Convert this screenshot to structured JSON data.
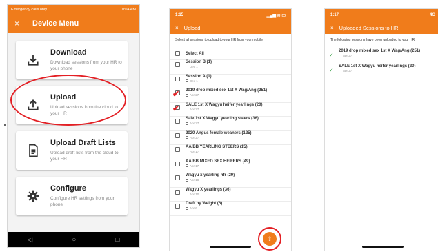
{
  "phone1": {
    "status_left": "Emergency calls only",
    "status_right": "10:04 AM",
    "close_glyph": "×",
    "title": "Device Menu",
    "cards": [
      {
        "title": "Download",
        "desc": "Download sessions from your HR to your phone",
        "icon": "download-icon"
      },
      {
        "title": "Upload",
        "desc": "Upload sessions from the cloud to your HR",
        "icon": "upload-icon"
      },
      {
        "title": "Upload Draft Lists",
        "desc": "Upload draft lists from the cloud to your HR",
        "icon": "draft-list-icon"
      },
      {
        "title": "Configure",
        "desc": "Configure HR settings from your phone",
        "icon": "gear-icon"
      }
    ],
    "nav": [
      "◁",
      "○",
      "□"
    ]
  },
  "phone2": {
    "time": "1:15",
    "close_glyph": "×",
    "title": "Upload",
    "intro": "Select all sessions to upload to your HR from your mobile",
    "select_all": "Select All",
    "sessions": [
      {
        "name": "Session B (1)",
        "date": "Dec 1",
        "checked": false
      },
      {
        "name": "Session A (0)",
        "date": "Dec 1",
        "checked": false
      },
      {
        "name": "2019 drop mixed sex 1st X Wag/Ang (251)",
        "date": "Apr 27",
        "checked": true
      },
      {
        "name": "SALE 1st X Wagyu heifer yearlings (20)",
        "date": "Apr 27",
        "checked": true
      },
      {
        "name": "Sale 1st X Wagyu yearling steers (36)",
        "date": "Apr 27",
        "checked": false
      },
      {
        "name": "2020 Angus female weaners (125)",
        "date": "Apr 27",
        "checked": false
      },
      {
        "name": "AA/BB YEARLING STEERS (15)",
        "date": "Apr 17",
        "checked": false
      },
      {
        "name": "AA/BB MIXED SEX HEIFERS (49)",
        "date": "Apr 17",
        "checked": false
      },
      {
        "name": "Wagyu x yearling hfr (20)",
        "date": "Apr 18",
        "checked": false
      },
      {
        "name": "Wagyu X yearlings (36)",
        "date": "Apr 10",
        "checked": false
      },
      {
        "name": "Draft by Weight (6)",
        "date": "Apr 6",
        "checked": false
      }
    ],
    "fab_glyph": "⇧"
  },
  "phone3": {
    "time": "1:17",
    "signal": "4G",
    "close_glyph": "×",
    "title": "Uploaded Sessions to HR",
    "intro": "The following sessions have been uploaded to your HR",
    "done": [
      {
        "name": "2019 drop mixed sex 1st X Wag/Ang (251)",
        "date": "Apr 27"
      },
      {
        "name": "SALE 1st X Wagyu heifer yearlings (20)",
        "date": "Apr 27"
      }
    ]
  },
  "colors": {
    "accent": "#f07c1b",
    "highlight": "#e31f24",
    "success": "#2e9b3d"
  }
}
